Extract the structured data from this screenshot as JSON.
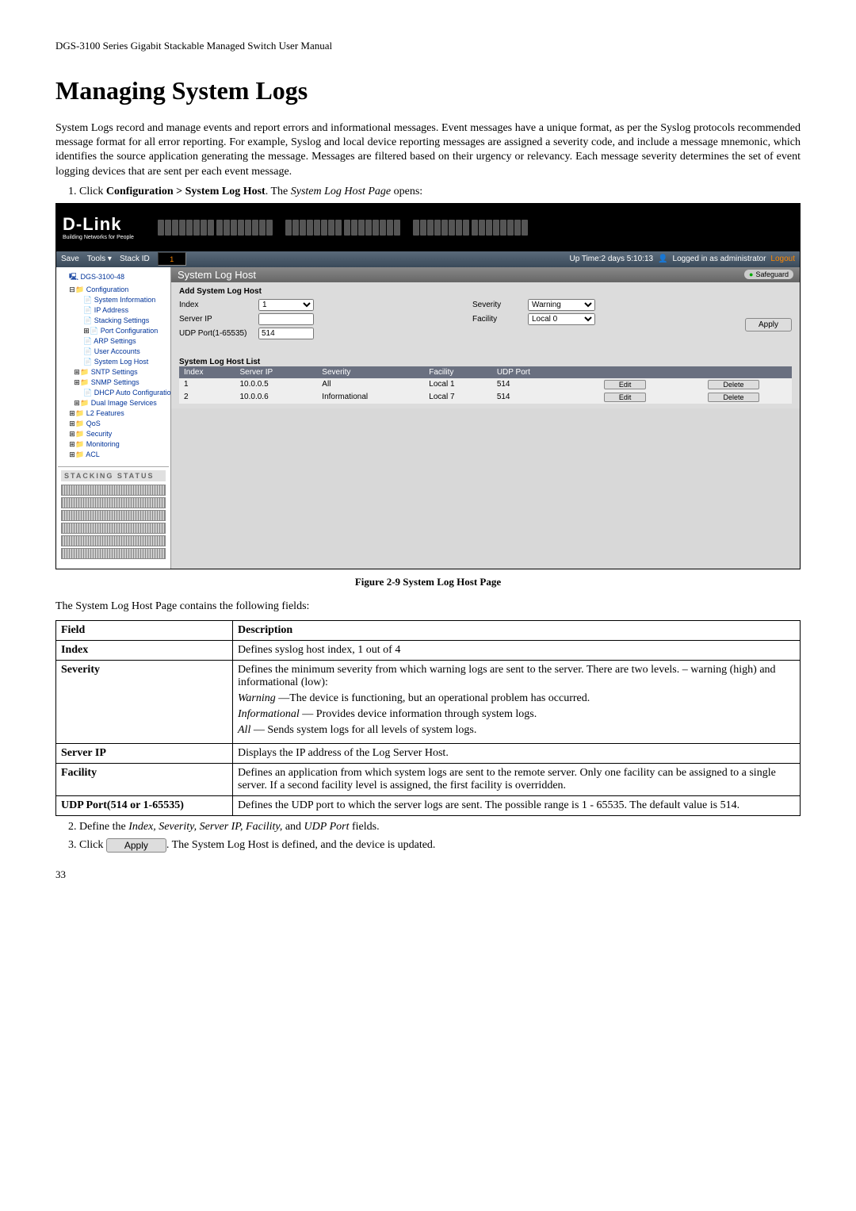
{
  "doc_header": "DGS-3100 Series Gigabit Stackable Managed Switch User Manual",
  "page_title": "Managing System Logs",
  "intro": "System Logs record and manage events and report errors and informational messages. Event messages have a unique format, as per the Syslog protocols recommended message format for all error reporting. For example, Syslog and local device reporting messages are assigned a severity code, and include a message mnemonic, which identifies the source application generating the message. Messages are filtered based on their urgency or relevancy. Each message severity determines the set of event logging devices that are sent per each event message.",
  "step1_prefix": "Click ",
  "step1_bold": "Configuration > System Log Host",
  "step1_mid": ". The ",
  "step1_italic": "System Log Host Page",
  "step1_suffix": " opens:",
  "screenshot": {
    "logo": "D-Link",
    "logo_sub": "Building Networks for People",
    "toolbar": {
      "save": "Save",
      "tools": "Tools",
      "stack_id_label": "Stack ID",
      "stack_id_value": "1",
      "uptime": "Up Time:2 days 5:10:13",
      "logged_in": "Logged in as administrator",
      "logout": "Logout"
    },
    "tree": {
      "root": "DGS-3100-48",
      "config": "Configuration",
      "items": [
        "System Information",
        "IP Address",
        "Stacking Settings",
        "Port Configuration",
        "ARP Settings",
        "User Accounts",
        "System Log Host",
        "SNTP Settings",
        "SNMP Settings",
        "DHCP Auto Configuration",
        "Dual Image Services"
      ],
      "l2": "L2 Features",
      "qos": "QoS",
      "security": "Security",
      "monitoring": "Monitoring",
      "acl": "ACL"
    },
    "stacking_label": "STACKING STATUS",
    "content": {
      "title": "System Log Host",
      "safeguard": "Safeguard",
      "add_title": "Add System Log Host",
      "labels": {
        "index": "Index",
        "server_ip": "Server IP",
        "udp_port": "UDP Port(1-65535)",
        "severity": "Severity",
        "facility": "Facility"
      },
      "values": {
        "index": "1",
        "udp_port": "514",
        "severity": "Warning",
        "facility": "Local 0"
      },
      "apply": "Apply",
      "list_title": "System Log Host List",
      "columns": [
        "Index",
        "Server IP",
        "Severity",
        "Facility",
        "UDP Port",
        "",
        ""
      ],
      "rows": [
        {
          "index": "1",
          "server_ip": "10.0.0.5",
          "severity": "All",
          "facility": "Local 1",
          "udp_port": "514",
          "edit": "Edit",
          "delete": "Delete"
        },
        {
          "index": "2",
          "server_ip": "10.0.0.6",
          "severity": "Informational",
          "facility": "Local 7",
          "udp_port": "514",
          "edit": "Edit",
          "delete": "Delete"
        }
      ]
    }
  },
  "figure_caption": "Figure 2-9 System Log Host Page",
  "fields_intro": "The System Log Host Page contains the following fields:",
  "fields_table": {
    "head_field": "Field",
    "head_desc": "Description",
    "rows": [
      {
        "field": "Index",
        "desc": "Defines syslog host index, 1 out of 4"
      },
      {
        "field": "Severity",
        "desc": "Defines the minimum severity from which warning logs are sent to the server. There are two levels. – warning (high) and informational (low):",
        "bullets": [
          {
            "i": "Warning",
            "t": " —The device is functioning, but an operational problem has occurred."
          },
          {
            "i": "Informational",
            "t": " — Provides device information through  system logs."
          },
          {
            "i": "All",
            "t": " — Sends system logs for all levels of system logs."
          }
        ]
      },
      {
        "field": "Server IP",
        "desc": "Displays the IP address of the Log Server Host."
      },
      {
        "field": "Facility",
        "desc": "Defines an application from which system logs are sent to the remote server. Only one facility can be assigned to a single server. If a second facility level is assigned, the first facility is overridden."
      },
      {
        "field": "UDP Port(514 or 1-65535)",
        "desc": "Defines the UDP port to which the server logs are sent. The possible range is 1 - 65535. The default value is 514."
      }
    ]
  },
  "step2_prefix": "Define the ",
  "step2_italic": "Index, Severity, Server IP, Facility,",
  "step2_mid": " and ",
  "step2_italic2": "UDP Port",
  "step2_suffix": " fields.",
  "step3_prefix": "Click ",
  "step3_button": "Apply",
  "step3_suffix": ". The System Log Host is defined, and the device is updated.",
  "page_number": "33"
}
